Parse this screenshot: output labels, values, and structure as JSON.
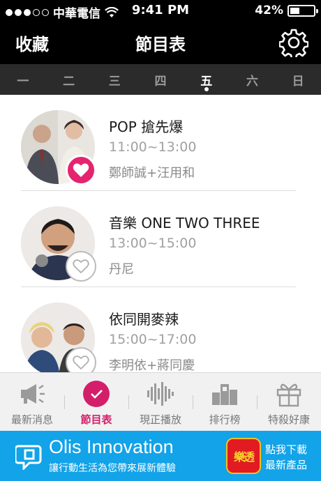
{
  "status_bar": {
    "carrier": "中華電信",
    "time": "9:41 PM",
    "battery": "42%",
    "battery_level": 0.42
  },
  "header": {
    "left_label": "收藏",
    "title": "節目表"
  },
  "days": [
    "一",
    "二",
    "三",
    "四",
    "五",
    "六",
    "日"
  ],
  "active_day": "五",
  "programs": [
    {
      "name": "POP 搶先爆",
      "time": "11:00~13:00",
      "hosts": "鄭師誠+汪用和",
      "favorited": true
    },
    {
      "name": "音樂 ONE TWO THREE",
      "time": "13:00~15:00",
      "hosts": "丹尼",
      "favorited": false
    },
    {
      "name": "依同開麥辣",
      "time": "15:00~17:00",
      "hosts": "李明依+蔣同慶",
      "favorited": false
    }
  ],
  "nav": {
    "items": [
      {
        "label": "最新消息",
        "icon": "megaphone-icon"
      },
      {
        "label": "節目表",
        "icon": "clock-icon"
      },
      {
        "label": "現正播放",
        "icon": "soundwave-icon"
      },
      {
        "label": "排行榜",
        "icon": "podium-icon"
      },
      {
        "label": "特殺好康",
        "icon": "gift-icon"
      }
    ],
    "active": "節目表",
    "accent": "#d31f6a"
  },
  "banner": {
    "brand": "Olis Innovation",
    "tagline": "讓行動生活為您帶來展新體驗",
    "app_icon_text": "樂透",
    "cta_line1": "點我下載",
    "cta_line2": "最新產品",
    "background": "#12a3e8"
  }
}
